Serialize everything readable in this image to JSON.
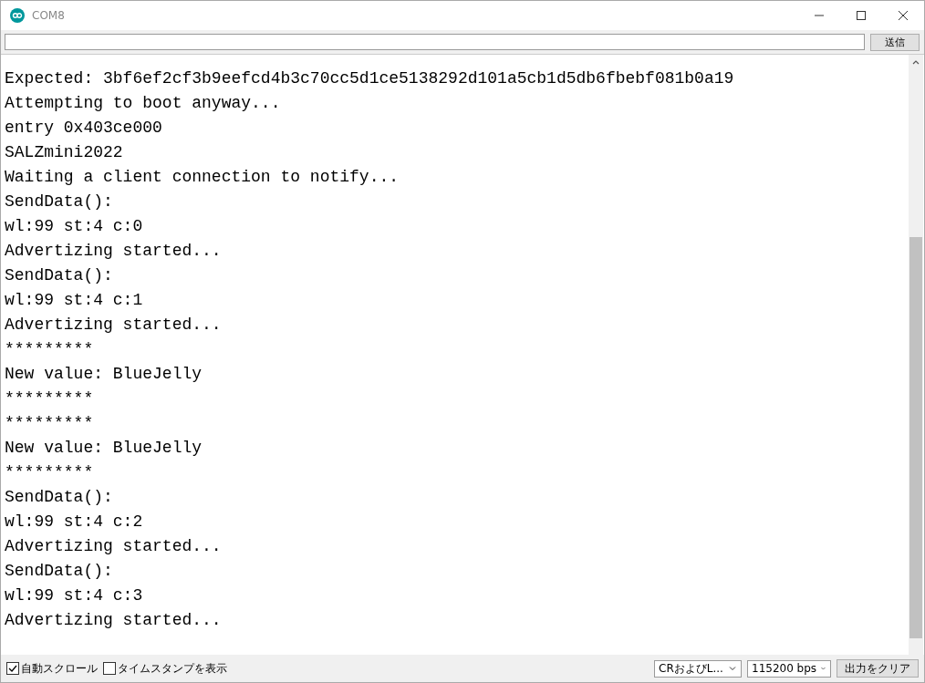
{
  "window": {
    "title": "COM8"
  },
  "send_button": "送信",
  "console_lines": [
    "Expected: 3bf6ef2cf3b9eefcd4b3c70cc5d1ce5138292d101a5cb1d5db6fbebf081b0a19",
    "Attempting to boot anyway...",
    "entry 0x403ce000",
    "SALZmini2022",
    "Waiting a client connection to notify...",
    "SendData():",
    "wl:99 st:4 c:0",
    "Advertizing started...",
    "SendData():",
    "wl:99 st:4 c:1",
    "Advertizing started...",
    "*********",
    "New value: BlueJelly",
    "*********",
    "*********",
    "New value: BlueJelly",
    "*********",
    "SendData():",
    "wl:99 st:4 c:2",
    "Advertizing started...",
    "SendData():",
    "wl:99 st:4 c:3",
    "Advertizing started..."
  ],
  "status_bar": {
    "options": [
      {
        "label": "自動スクロール",
        "checked": true
      },
      {
        "label": "タイムスタンプを表示",
        "checked": false
      }
    ],
    "line_ending": "CRおよびL...",
    "baud_rate": "115200 bps",
    "clear_button": "出力をクリア"
  }
}
